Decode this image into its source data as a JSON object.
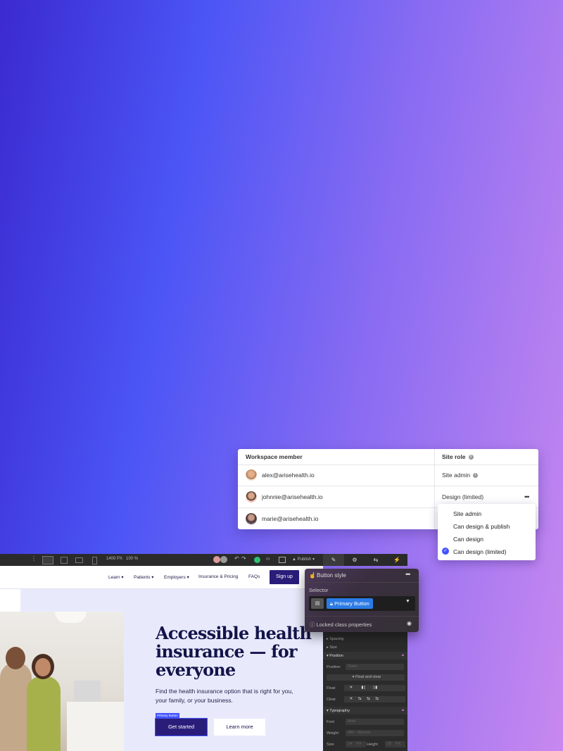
{
  "members": {
    "header": {
      "member": "Workspace member",
      "role": "Site role"
    },
    "rows": [
      {
        "email": "alex@arisehealth.io",
        "role": "Site admin"
      },
      {
        "email": "johnnie@arisehealth.io",
        "role": "Design (limited)"
      },
      {
        "email": "marie@arisehealth.io",
        "role": ""
      }
    ],
    "more": "•••"
  },
  "role_dropdown": {
    "options": [
      "Site admin",
      "Can design & publish",
      "Can design",
      "Can design (limited)"
    ],
    "selected": "Can design (limited)"
  },
  "topbar": {
    "width": "1400 PX",
    "zoom": "100 %",
    "publish": "Publish"
  },
  "site": {
    "nav": [
      "Learn",
      "Patients",
      "Employers",
      "Insurance & Pricing",
      "FAQs"
    ],
    "signup": "Sign up",
    "title": "Accessible health insurance — for everyone",
    "subtitle": "Find the health insurance option that is right for you, your family, or your business.",
    "primary_tag": "Primary Button",
    "get_started": "Get started",
    "learn_more": "Learn more"
  },
  "style_popup": {
    "title": "Button style",
    "selector_label": "Selector",
    "selector_value": "Primary Button",
    "locked": "Locked class properties"
  },
  "style_panel": {
    "spacing": "Spacing",
    "size": "Size",
    "position": "Position",
    "position_label": "Position",
    "position_value": "Static",
    "float_clear": "Float and clear",
    "float": "Float",
    "clear": "Clear",
    "typography": "Typography",
    "font": "Font",
    "font_value": "Arial",
    "weight": "Weight",
    "weight_value": "400 - Normal",
    "size_label": "Size",
    "size_value": "14",
    "size_unit": "PX",
    "height_label": "Height",
    "height_value": "20",
    "height_unit": "PX"
  }
}
